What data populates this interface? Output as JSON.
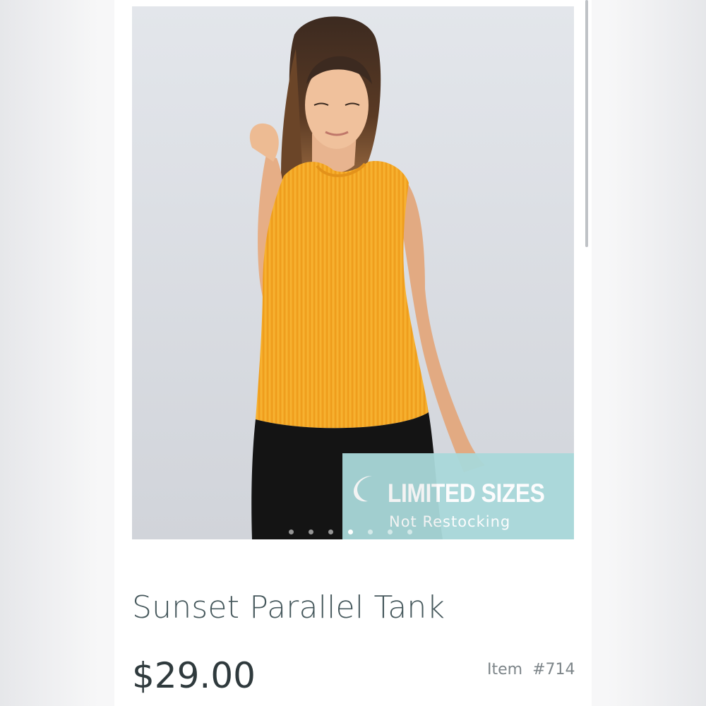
{
  "product": {
    "title": "Sunset Parallel Tank",
    "price": "$29.00",
    "item_label": "Item",
    "item_number": "#714"
  },
  "badge": {
    "title": "LIMITED SIZES",
    "subtitle": "Not Restocking",
    "icon": "crescent-moon-icon",
    "color": "#a9d9da"
  },
  "carousel": {
    "slide_count": 7,
    "active_slide": 4
  },
  "colors": {
    "tank": "#f4a623",
    "title_text": "#46585c",
    "price_text": "#2f3a3d"
  }
}
